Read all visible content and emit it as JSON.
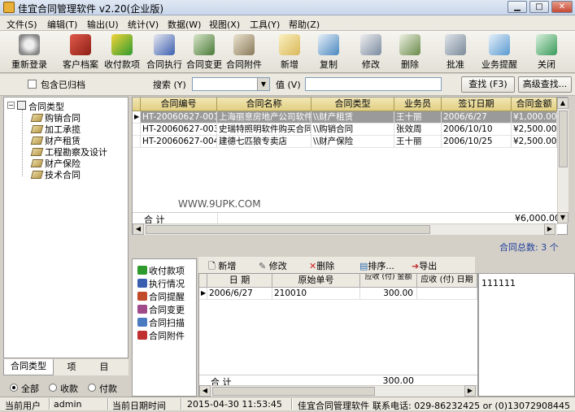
{
  "window": {
    "title": "佳宜合同管理软件 v2.20(企业版)"
  },
  "menu": [
    "文件(S)",
    "编辑(T)",
    "输出(U)",
    "统计(V)",
    "数据(W)",
    "视图(X)",
    "工具(Y)",
    "帮助(Z)"
  ],
  "toolbar": [
    {
      "label": "重新登录",
      "icon": "relogin-icon",
      "color": "#8a8a8a"
    },
    {
      "label": "客户档案",
      "icon": "customer-file-icon",
      "color": "#c0392b"
    },
    {
      "label": "收付款项",
      "icon": "payments-icon",
      "color": "#2e9b2e"
    },
    {
      "label": "合同执行",
      "icon": "contract-execute-icon",
      "color": "#3a5fb0"
    },
    {
      "label": "合同变更",
      "icon": "contract-change-icon",
      "color": "#4a7a3a"
    },
    {
      "label": "合同附件",
      "icon": "contract-attachment-icon",
      "color": "#9a8a6a"
    },
    {
      "label": "新增",
      "icon": "add-icon",
      "color": "#d9b85a"
    },
    {
      "label": "复制",
      "icon": "copy-icon",
      "color": "#4a88c0"
    },
    {
      "label": "修改",
      "icon": "edit-icon",
      "color": "#7a8aa0"
    },
    {
      "label": "删除",
      "icon": "delete-icon",
      "color": "#6a8a4a"
    },
    {
      "label": "批准",
      "icon": "approve-icon",
      "color": "#7a8a9a"
    },
    {
      "label": "业务提醒",
      "icon": "reminder-icon",
      "color": "#5a9ad0"
    },
    {
      "label": "关闭",
      "icon": "close-door-icon",
      "color": "#3a9a5a"
    }
  ],
  "filter": {
    "include_archived": "包含已归档",
    "search_label": "搜索 (Y)",
    "value_label": "值 (V)",
    "find_button": "查找 (F3)",
    "advanced_button": "高级查找..."
  },
  "tree": {
    "root": "合同类型",
    "children": [
      "购销合同",
      "加工承揽",
      "财产租赁",
      "工程勘察及设计",
      "财产保险",
      "技术合同"
    ]
  },
  "left_tabs": [
    "合同类型",
    "项",
    "目"
  ],
  "radio": {
    "all": "全部",
    "income": "收款",
    "payment": "付款"
  },
  "grid": {
    "columns": [
      "合同编号",
      "合同名称",
      "合同类型",
      "业务员",
      "签订日期",
      "合同金额"
    ],
    "rows": [
      [
        "HT-20060627-001",
        "上海丽意房地产公司软件",
        "\\\\财产租赁",
        "王十丽",
        "2006/6/27",
        "¥1,000.00"
      ],
      [
        "HT-20060627-003",
        "史瑞特照明软件购买合同",
        "\\\\购销合同",
        "张效周",
        "2006/10/10",
        "¥2,500.00"
      ],
      [
        "HT-20060627-004",
        "建德七匹狼专卖店",
        "\\\\财产保险",
        "王十丽",
        "2006/10/25",
        "¥2,500.00"
      ]
    ],
    "total_label": "合  计",
    "total_value": "¥6,000.00",
    "watermark": "WWW.9UPK.COM",
    "count_label": "合同总数:",
    "count_value": "3 个"
  },
  "side_list": [
    {
      "label": "收付款项",
      "color": "#2e9b2e"
    },
    {
      "label": "执行情况",
      "color": "#3a5fb0"
    },
    {
      "label": "合同提醒",
      "color": "#c04a2a"
    },
    {
      "label": "合同变更",
      "color": "#a04a8a"
    },
    {
      "label": "合同扫描",
      "color": "#4a7ac0"
    },
    {
      "label": "合同附件",
      "color": "#c03030"
    }
  ],
  "subtool": {
    "add": "新增",
    "edit": "修改",
    "delete": "删除",
    "sort": "排序...",
    "export": "导出"
  },
  "subgrid": {
    "columns": [
      "日  期",
      "原始单号",
      "应收 (付) 金额",
      "应收 (付) 日期"
    ],
    "rows": [
      [
        "2006/6/27",
        "210010",
        "300.00",
        ""
      ]
    ],
    "total_label": "合  计",
    "total_value": "300.00"
  },
  "memo": "111111",
  "status": {
    "user_label": "当前用户",
    "user": "admin",
    "date_label": "当前日期时间",
    "datetime": "2015-04-30 11:53:45",
    "product": "佳宜合同管理软件",
    "phone": "联系电话: 029-86232425 or (0)13072908445"
  }
}
